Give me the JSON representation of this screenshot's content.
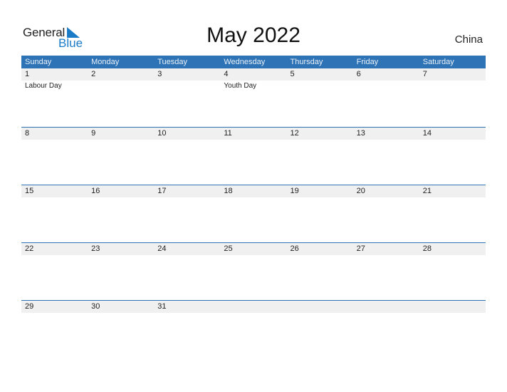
{
  "logo": {
    "line1": "General",
    "line2": "Blue"
  },
  "title": "May 2022",
  "country": "China",
  "colors": {
    "accent": "#2e73b6",
    "logo_blue": "#1a7cc7",
    "day_strip": "#f0f0f0"
  },
  "weekdays": [
    "Sunday",
    "Monday",
    "Tuesday",
    "Wednesday",
    "Thursday",
    "Friday",
    "Saturday"
  ],
  "weeks": [
    {
      "days": [
        "1",
        "2",
        "3",
        "4",
        "5",
        "6",
        "7"
      ],
      "events": [
        "Labour Day",
        "",
        "",
        "Youth Day",
        "",
        "",
        ""
      ]
    },
    {
      "days": [
        "8",
        "9",
        "10",
        "11",
        "12",
        "13",
        "14"
      ],
      "events": [
        "",
        "",
        "",
        "",
        "",
        "",
        ""
      ]
    },
    {
      "days": [
        "15",
        "16",
        "17",
        "18",
        "19",
        "20",
        "21"
      ],
      "events": [
        "",
        "",
        "",
        "",
        "",
        "",
        ""
      ]
    },
    {
      "days": [
        "22",
        "23",
        "24",
        "25",
        "26",
        "27",
        "28"
      ],
      "events": [
        "",
        "",
        "",
        "",
        "",
        "",
        ""
      ]
    },
    {
      "days": [
        "29",
        "30",
        "31",
        "",
        "",
        "",
        ""
      ],
      "events": [
        "",
        "",
        "",
        "",
        "",
        "",
        ""
      ]
    }
  ]
}
